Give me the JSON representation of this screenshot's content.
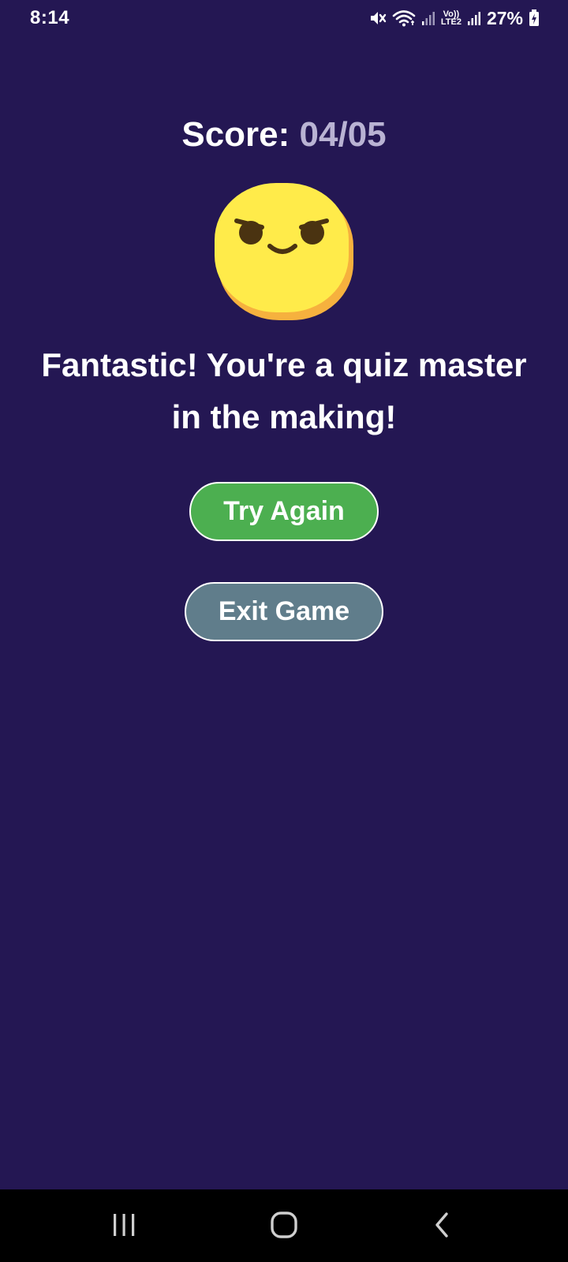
{
  "status_bar": {
    "time": "8:14",
    "lte_line1": "Vo))",
    "lte_line2": "LTE2",
    "battery": "27%"
  },
  "score": {
    "label": "Score:",
    "value": "04/05"
  },
  "message": "Fantastic! You're a quiz master in the making!",
  "buttons": {
    "try_again": "Try Again",
    "exit_game": "Exit Game"
  },
  "colors": {
    "background": "#241753",
    "try_again": "#4caf50",
    "exit_game": "#607d8b",
    "score_value": "#b9b3d3",
    "emoji_face": "#ffeb4a",
    "emoji_shadow": "#f6b13e"
  },
  "icons": {
    "status": [
      "mute-icon",
      "wifi-icon",
      "signal-icon",
      "battery-charging-icon"
    ],
    "emoji": "smirk-emoji-icon",
    "nav": [
      "recents-icon",
      "home-icon",
      "back-icon"
    ]
  }
}
